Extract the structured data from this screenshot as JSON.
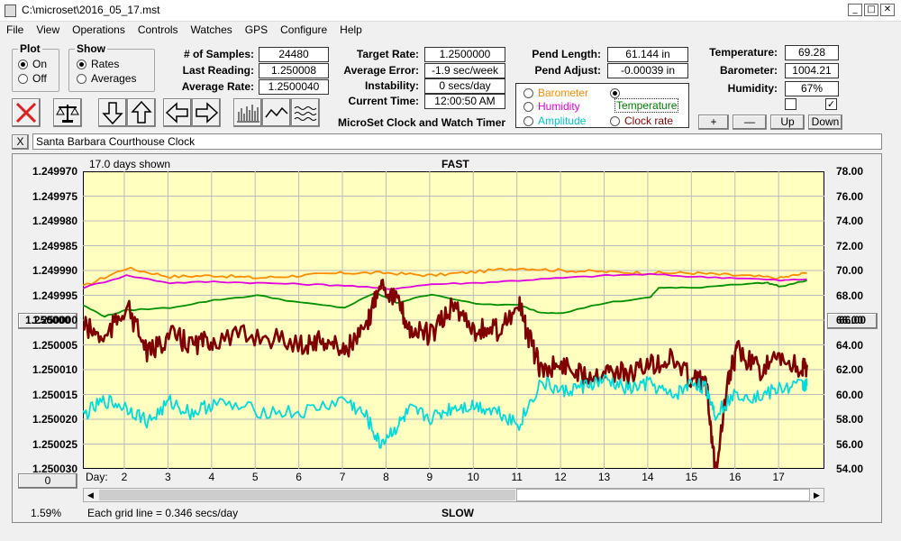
{
  "window": {
    "title": "C:\\microset\\2016_05_17.mst",
    "minimize": "_",
    "restore": "□",
    "close": "✕"
  },
  "menu": [
    "File",
    "View",
    "Operations",
    "Controls",
    "Watches",
    "GPS",
    "Configure",
    "Help"
  ],
  "plot_group": {
    "title": "Plot",
    "options": [
      "On",
      "Off"
    ],
    "selected": "On"
  },
  "show_group": {
    "title": "Show",
    "options": [
      "Rates",
      "Averages"
    ],
    "selected": "Rates"
  },
  "stats": {
    "samples_label": "# of Samples:",
    "samples": "24480",
    "last_label": "Last Reading:",
    "last": "1.250008",
    "avg_label": "Average Rate:",
    "avg": "1.2500040",
    "target_label": "Target Rate:",
    "target": "1.2500000",
    "error_label": "Average Error:",
    "error": "-1.9 sec/week",
    "instab_label": "Instability:",
    "instab": "0 secs/day",
    "time_label": "Current Time:",
    "time": "12:00:50 AM",
    "pendlen_label": "Pend Length:",
    "pendlen": "61.144 in",
    "pendadj_label": "Pend Adjust:",
    "pendadj": "-0.00039 in",
    "temp_label": "Temperature:",
    "temp": "69.28",
    "baro_label": "Barometer:",
    "baro": "1004.21",
    "hum_label": "Humidity:",
    "hum": "67%"
  },
  "app_caption": "MicroSet Clock and Watch Timer",
  "aux_options": [
    {
      "label": "Barometer",
      "color": "#ff8c00",
      "checked": false
    },
    {
      "label": "Temperature",
      "color": "#008000",
      "checked": true
    },
    {
      "label": "Humidity",
      "color": "#e000e0",
      "checked": false
    },
    {
      "label": "Clock rate",
      "color": "#8b0000",
      "checked": false
    },
    {
      "label": "Amplitude",
      "color": "#00c8c8",
      "checked": false
    }
  ],
  "adjust_buttons": [
    "+",
    "—",
    "Up",
    "Down"
  ],
  "checkboxes": [
    false,
    true
  ],
  "clock_name": "Santa Barbara Courthouse Clock",
  "clear_label": "X",
  "chart_header": {
    "days_shown": "17.0 days shown",
    "fast": "FAST",
    "slow": "SLOW",
    "grid_note": "Each grid line = 0.346 secs/day",
    "percent": "1.59%",
    "left_button": "1.250000",
    "right_button": "66.00",
    "left_bottom_button": "0"
  },
  "chart_data": {
    "type": "line",
    "x_label": "Day:",
    "x_ticks": [
      "2",
      "3",
      "4",
      "5",
      "6",
      "7",
      "8",
      "9",
      "10",
      "11",
      "12",
      "13",
      "14",
      "15",
      "16",
      "17"
    ],
    "x_range": [
      1,
      18.0
    ],
    "y_left_ticks": [
      "1.249970",
      "1.249975",
      "1.249980",
      "1.249985",
      "1.249990",
      "1.249995",
      "1.250000",
      "1.250005",
      "1.250010",
      "1.250015",
      "1.250020",
      "1.250025",
      "1.250030"
    ],
    "y_left_range": [
      1.24997,
      1.25003
    ],
    "y_right_ticks": [
      "78.00",
      "76.00",
      "74.00",
      "72.00",
      "70.00",
      "68.00",
      "66.00",
      "64.00",
      "62.00",
      "60.00",
      "58.00",
      "56.00",
      "54.00"
    ],
    "y_right_range": [
      78,
      54
    ],
    "grid": true,
    "series": [
      {
        "name": "Barometer",
        "color": "#ff8c00",
        "axis": "right",
        "x": [
          1,
          2,
          3,
          4,
          5,
          6,
          7,
          8,
          9,
          10,
          11,
          12,
          13,
          14,
          15,
          16,
          17,
          17.6
        ],
        "y": [
          68.7,
          70.2,
          69.5,
          69.6,
          69.4,
          69.6,
          69.8,
          69.8,
          69.6,
          69.9,
          70.2,
          70.0,
          69.9,
          69.8,
          69.8,
          69.6,
          69.4,
          69.8
        ]
      },
      {
        "name": "Humidity",
        "color": "#e000e0",
        "axis": "right",
        "x": [
          1,
          2,
          3,
          4,
          5,
          6,
          7,
          8,
          9,
          10,
          11,
          12,
          13,
          14,
          15,
          16,
          17,
          17.6
        ],
        "y": [
          68.6,
          69.6,
          69.0,
          69.1,
          69.0,
          68.9,
          68.8,
          68.5,
          68.9,
          69.0,
          69.2,
          69.4,
          69.6,
          69.7,
          69.5,
          69.4,
          69.2,
          69.3
        ]
      },
      {
        "name": "Temperature",
        "color": "#009000",
        "axis": "right",
        "x": [
          1,
          1.5,
          2,
          3,
          4,
          5,
          6,
          7,
          7.7,
          8.2,
          9,
          10,
          11,
          11.5,
          12,
          13,
          14,
          14.2,
          15,
          16,
          16.7,
          17,
          17.6
        ],
        "y": [
          67.2,
          66.3,
          66.8,
          67.0,
          67.6,
          68.0,
          67.4,
          67.0,
          68.2,
          67.4,
          68.1,
          67.3,
          67.2,
          66.6,
          66.6,
          67.4,
          67.8,
          68.6,
          68.6,
          68.9,
          69.0,
          68.7,
          69.2
        ]
      },
      {
        "name": "Clock rate",
        "color": "#800000",
        "axis": "left",
        "x": [
          1,
          1.5,
          2,
          2.5,
          3,
          3.5,
          4,
          5,
          6,
          6.5,
          7,
          7.5,
          7.8,
          8.2,
          8.5,
          9,
          9.5,
          10,
          10.5,
          11,
          11.2,
          11.5,
          12,
          12.5,
          13,
          13.5,
          14,
          14.5,
          15,
          15.3,
          15.5,
          15.8,
          16,
          16.5,
          17,
          17.5,
          17.6
        ],
        "y": [
          1.250001,
          1.250004,
          1.249997,
          1.250007,
          1.250003,
          1.250005,
          1.250004,
          1.250003,
          1.250005,
          1.250004,
          1.250006,
          1.250002,
          1.249992,
          1.249996,
          1.250002,
          1.250003,
          1.249997,
          1.250002,
          1.250002,
          1.249997,
          1.250003,
          1.25001,
          1.250009,
          1.250011,
          1.25001,
          1.250011,
          1.250009,
          1.250008,
          1.250012,
          1.250013,
          1.25003,
          1.250012,
          1.250006,
          1.25001,
          1.250008,
          1.25001,
          1.250009
        ]
      },
      {
        "name": "Amplitude",
        "color": "#00dcdc",
        "axis": "right",
        "x": [
          1,
          1.5,
          2,
          2.5,
          3,
          3.5,
          4,
          5,
          6,
          7,
          7.5,
          7.8,
          8.2,
          8.5,
          9,
          9.5,
          10,
          10.5,
          11,
          11.5,
          12,
          12.5,
          13,
          13.5,
          14,
          14.5,
          15,
          15.3,
          15.5,
          16,
          16.5,
          17,
          17.5,
          17.6
        ],
        "y": [
          58.3,
          59.5,
          59.0,
          57.8,
          59.4,
          58.5,
          59.3,
          58.7,
          58.5,
          59.6,
          58.2,
          56.0,
          57.4,
          58.7,
          58.1,
          59.0,
          59.1,
          58.7,
          57.6,
          61.0,
          60.2,
          60.7,
          61.1,
          60.4,
          60.9,
          59.8,
          61.0,
          60.4,
          58.5,
          60.1,
          59.8,
          60.5,
          60.8,
          60.7
        ]
      }
    ]
  }
}
